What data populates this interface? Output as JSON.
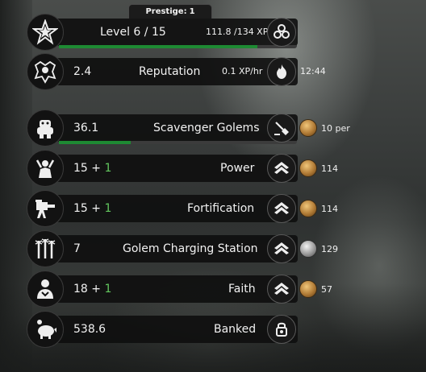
{
  "prestige": {
    "label": "Prestige:",
    "value": "1"
  },
  "level": {
    "label": "Level",
    "current": "6",
    "separator": "/",
    "max": "15",
    "xp_text": "111.8 /134 XP",
    "xp_progress": 0.834
  },
  "reputation": {
    "value": "2.4",
    "label": "Reputation",
    "rate": "0.1 XP/hr",
    "timer": "12:44"
  },
  "resources": [
    {
      "value": "36.1",
      "bonus": "",
      "label": "Scavenger Golems",
      "cost": "10 per",
      "coin": "gold",
      "progress": 0.3
    },
    {
      "value": "15 + ",
      "bonus": "1",
      "label": "Power",
      "cost": "114",
      "coin": "gold"
    },
    {
      "value": "15 + ",
      "bonus": "1",
      "label": "Fortification",
      "cost": "114",
      "coin": "gold"
    },
    {
      "value": "7",
      "bonus": "",
      "label": "Golem Charging Station",
      "cost": "129",
      "coin": "silver"
    },
    {
      "value": "18 + ",
      "bonus": "1",
      "label": "Faith",
      "cost": "57",
      "coin": "gold"
    }
  ],
  "banked": {
    "value": "538.6",
    "label": "Banked"
  },
  "colors": {
    "bonus_green": "#63c85f",
    "progress_green": "#1e8a33",
    "bar_bg": "#0e0e0e"
  }
}
